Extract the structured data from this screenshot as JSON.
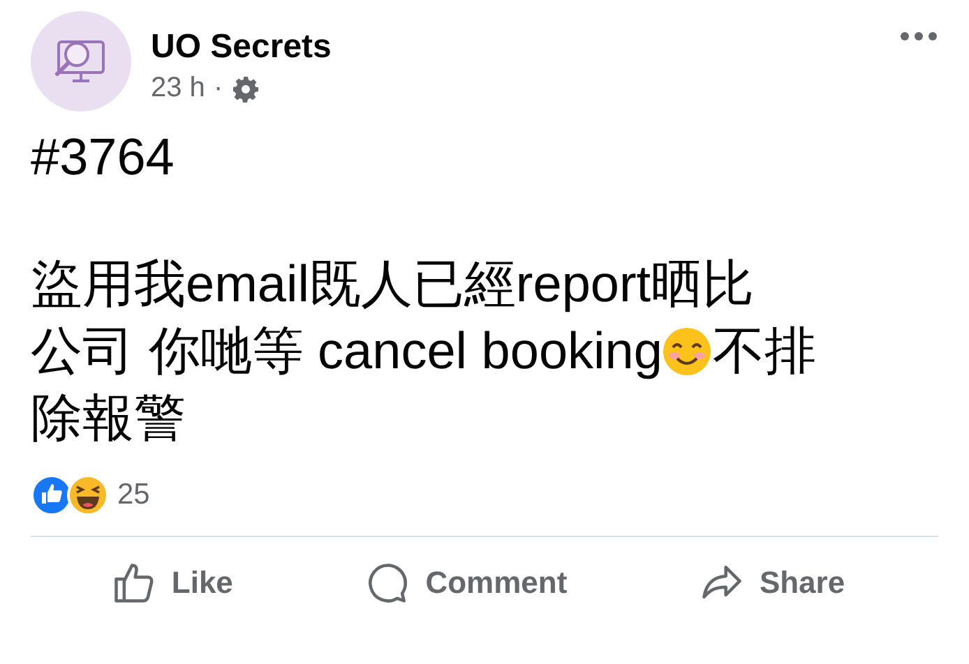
{
  "post": {
    "author": "UO Secrets",
    "time": "23 h",
    "separator": "·",
    "number": "#3764",
    "body_lines": [
      [
        {
          "kind": "text",
          "text": "盜用我email既人已經report晒比"
        }
      ],
      [
        {
          "kind": "text",
          "text": "公司 你哋等 cancel booking"
        },
        {
          "kind": "emoji"
        },
        {
          "kind": "text",
          "text": "不排"
        }
      ],
      [
        {
          "kind": "text",
          "text": "除報警"
        }
      ]
    ],
    "reaction_count": "25"
  },
  "actions": [
    {
      "kind": "like",
      "label": "Like"
    },
    {
      "kind": "comment",
      "label": "Comment"
    },
    {
      "kind": "share",
      "label": "Share"
    }
  ]
}
